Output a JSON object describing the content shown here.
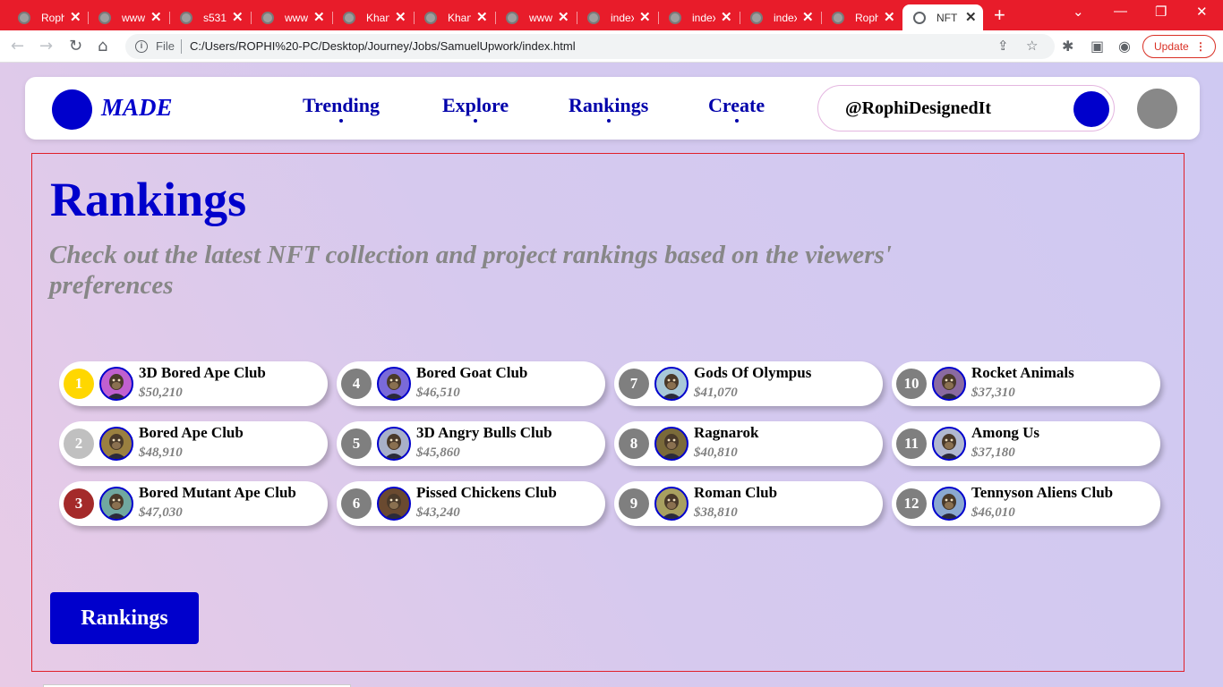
{
  "browser": {
    "tabs": [
      {
        "title": "Rophi"
      },
      {
        "title": "www."
      },
      {
        "title": "s531"
      },
      {
        "title": "www."
      },
      {
        "title": "Khan"
      },
      {
        "title": "Khan"
      },
      {
        "title": "www."
      },
      {
        "title": "index"
      },
      {
        "title": "index"
      },
      {
        "title": "index"
      },
      {
        "title": "Rophi"
      },
      {
        "title": "NFT"
      }
    ],
    "close_glyph": "✕",
    "new_tab_glyph": "+",
    "file_label": "File",
    "url": "C:/Users/ROPHI%20-PC/Desktop/Journey/Jobs/SamuelUpwork/index.html",
    "update_label": "Update"
  },
  "nav": {
    "brand": "MADE",
    "links": [
      "Trending",
      "Explore",
      "Rankings",
      "Create"
    ],
    "handle": "@RophiDesignedIt"
  },
  "rankings": {
    "title": "Rankings",
    "subtitle": "Check out the latest NFT collection and project rankings based on the viewers' preferences",
    "items": [
      {
        "rank": "1",
        "name": "3D Bored Ape Club",
        "price": "$50,210",
        "img_bg": "#c060d0"
      },
      {
        "rank": "2",
        "name": "Bored Ape Club",
        "price": "$48,910",
        "img_bg": "#9a8040"
      },
      {
        "rank": "3",
        "name": "Bored Mutant Ape Club",
        "price": "$47,030",
        "img_bg": "#70a8a0"
      },
      {
        "rank": "4",
        "name": "Bored Goat Club",
        "price": "$46,510",
        "img_bg": "#7a6ad8"
      },
      {
        "rank": "5",
        "name": "3D Angry Bulls Club",
        "price": "$45,860",
        "img_bg": "#a8b0c8"
      },
      {
        "rank": "6",
        "name": "Pissed Chickens Club",
        "price": "$43,240",
        "img_bg": "#6a4a30"
      },
      {
        "rank": "7",
        "name": "Gods Of Olympus",
        "price": "$41,070",
        "img_bg": "#a8c8d8"
      },
      {
        "rank": "8",
        "name": "Ragnarok",
        "price": "$40,810",
        "img_bg": "#7a6a3a"
      },
      {
        "rank": "9",
        "name": "Roman Club",
        "price": "$38,810",
        "img_bg": "#a8a060"
      },
      {
        "rank": "10",
        "name": "Rocket Animals",
        "price": "$37,310",
        "img_bg": "#8a6aa0"
      },
      {
        "rank": "11",
        "name": "Among Us",
        "price": "$37,180",
        "img_bg": "#b0b8d0"
      },
      {
        "rank": "12",
        "name": "Tennyson Aliens Club",
        "price": "$46,010",
        "img_bg": "#8aa8d0"
      }
    ],
    "button_label": "Rankings"
  },
  "colors": {
    "accent": "#0000cc",
    "gold": "#ffd700",
    "silver": "#c0c0c0",
    "bronze": "#a42a2a",
    "subtitle_gray": "#878787",
    "tabbar_red": "#e81c2a"
  }
}
